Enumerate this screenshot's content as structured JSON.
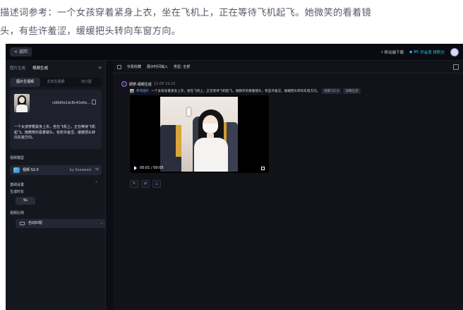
{
  "caption": {
    "line1": "描述词参考：一个女孩穿着紧身上衣，坐在飞机上，正在等待飞机起飞。她微笑的看着镜",
    "line2": "头，有些许羞涩，缓缓把头转向车窗方向。"
  },
  "topbar": {
    "back_label": "< 返回",
    "download_label": "移动端下载",
    "points_label": "85",
    "vip_label": "开会员 得积分"
  },
  "sidebar": {
    "tabs": [
      "图片生成",
      "视频生成"
    ],
    "active_tab": "视频生成",
    "mode_tabs": [
      "图片生视频",
      "文本生视频",
      "对口型"
    ],
    "active_mode": "图片生视频",
    "image_name": "cb8d0e1dc8c42e6e...",
    "prompt": "一个女孩穿着紧身上衣，坐在飞机上，正在等待飞机起飞。她微笑的看着镜头，有些许羞涩，缓缓把头转向车窗方向。",
    "model_section_label": "视频模型",
    "model_name": "视频 S2.0",
    "model_by": "by Seaweed",
    "basic_settings_label": "基础设置",
    "duration_label": "生成时长",
    "duration_value": "5s",
    "ratio_label": "视频比例",
    "ratio_value": "自动匹配"
  },
  "main": {
    "filter_items": [
      "仅看收藏",
      "展示时间输入",
      "类型: 全部"
    ],
    "task": {
      "title": "即梦-视频生成",
      "time": "11-09 19:22",
      "ref_label": "参考图片",
      "prompt": "一个女孩穿着紧身上衣，坐在飞机上，正在等待飞机起飞。她微笑的看着镜头，有些许羞涩，缓缓把头转向车窗方向。",
      "tag_model": "视频 S2.0",
      "tag_extra": "详细信息"
    },
    "player": {
      "time_label": "00:01 / 00:05"
    }
  },
  "colors": {
    "accent": "#8d7bd9",
    "vip": "#39c7f0",
    "background": "#0c0e14"
  }
}
